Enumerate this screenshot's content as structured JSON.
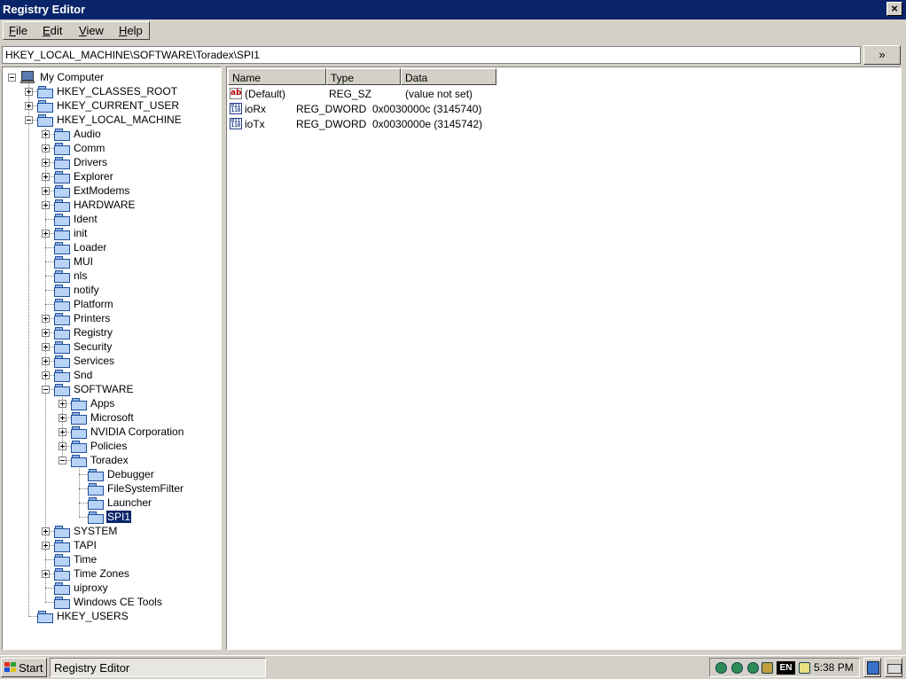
{
  "window": {
    "title": "Registry Editor",
    "close_label": "×"
  },
  "menu": [
    {
      "label": "File",
      "key": "F",
      "rest": "ile"
    },
    {
      "label": "Edit",
      "key": "E",
      "rest": "dit"
    },
    {
      "label": "View",
      "key": "V",
      "rest": "iew"
    },
    {
      "label": "Help",
      "key": "H",
      "rest": "elp"
    }
  ],
  "address": {
    "value": "HKEY_LOCAL_MACHINE\\SOFTWARE\\Toradex\\SPI1",
    "go_label": "»"
  },
  "tree": {
    "root": "My Computer",
    "nodes": [
      "HKEY_CLASSES_ROOT",
      "HKEY_CURRENT_USER",
      "HKEY_LOCAL_MACHINE",
      "Audio",
      "Comm",
      "Drivers",
      "Explorer",
      "ExtModems",
      "HARDWARE",
      "Ident",
      "init",
      "Loader",
      "MUI",
      "nls",
      "notify",
      "Platform",
      "Printers",
      "Registry",
      "Security",
      "Services",
      "Snd",
      "SOFTWARE",
      "Apps",
      "Microsoft",
      "NVIDIA Corporation",
      "Policies",
      "Toradex",
      "Debugger",
      "FileSystemFilter",
      "Launcher",
      "SPI1",
      "SYSTEM",
      "TAPI",
      "Time",
      "Time Zones",
      "uiproxy",
      "Windows CE Tools",
      "HKEY_USERS"
    ]
  },
  "list": {
    "columns": [
      "Name",
      "Type",
      "Data"
    ],
    "rows": [
      {
        "icon": "string-value-icon",
        "name": "(Default)",
        "type": "REG_SZ",
        "data": "(value not set)"
      },
      {
        "icon": "dword-value-icon",
        "name": "ioRx",
        "type": "REG_DWORD",
        "data": "0x0030000c (3145740)"
      },
      {
        "icon": "dword-value-icon",
        "name": "ioTx",
        "type": "REG_DWORD",
        "data": "0x0030000e (3145742)"
      }
    ]
  },
  "taskbar": {
    "start_label": "Start",
    "task_label": "Registry Editor",
    "language": "EN",
    "clock": "5:38 PM"
  }
}
